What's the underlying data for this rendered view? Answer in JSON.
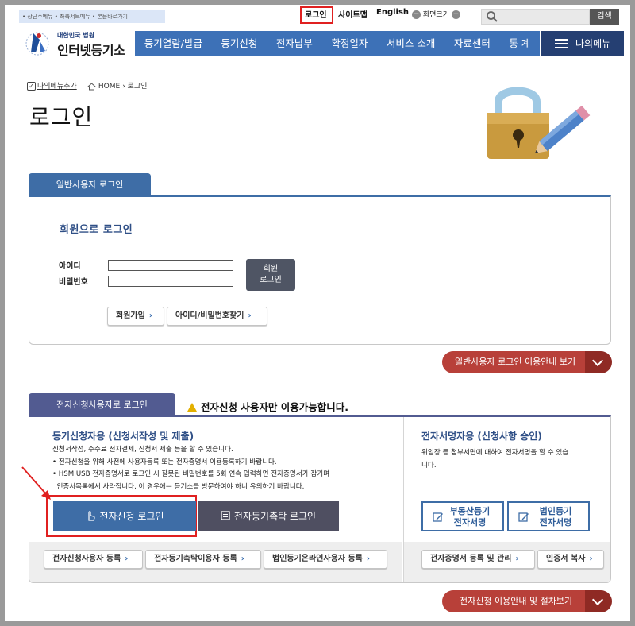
{
  "topbar": {
    "skip_links": "• 상단주메뉴 • 좌측서브메뉴 • 본문바로가기",
    "login": "로그인",
    "sitemap": "사이트맵",
    "english": "English",
    "zoom_label": "화면크기",
    "search_button": "검색"
  },
  "logo": {
    "org": "대한민국 법원",
    "name": "인터넷등기소"
  },
  "nav": {
    "items": [
      "등기열람/발급",
      "등기신청",
      "전자납부",
      "확정일자",
      "서비스 소개",
      "자료센터",
      "통 계"
    ],
    "my_menu": "나의메뉴"
  },
  "breadcrumb": {
    "add_menu": "나의메뉴추가",
    "home": "HOME",
    "current": "로그인"
  },
  "page_title": "로그인",
  "general": {
    "tab": "일반사용자 로그인",
    "member_title": "회원으로 로그인",
    "id_label": "아이디",
    "pw_label": "비밀번호",
    "id_value": "",
    "pw_value": "",
    "login_button_line1": "회원",
    "login_button_line2": "로그인",
    "join": "회원가입",
    "find": "아이디/비밀번호찾기",
    "guide": "일반사용자 로그인 이용안내 보기"
  },
  "efile": {
    "tab": "전자신청사용자로 로그인",
    "notice": "전자신청 사용자만 이용가능합니다.",
    "left_title": "등기신청자용 (신청서작성 및 제출)",
    "left_desc": [
      "신청서작성, 수수료 전자결제, 신청서 제출 등을 할 수 있습니다.",
      "• 전자신청을 위해 사전에 사용자등록 또는 전자증명서 이용등록하기 바랍니다.",
      "• HSM USB 전자증명서로 로그인 시 잘못된 비밀번호를 5회 연속 입력하면 전자증명서가 잠기며",
      "  인증서목록에서 사라집니다. 이 경우에는 등기소를 방문하여야 하니 유의하기 바랍니다."
    ],
    "btn_efile": "전자신청 로그인",
    "btn_trust": "전자등기촉탁 로그인",
    "left_links": [
      "전자신청사용자 등록",
      "전자등기촉탁이용자 등록",
      "법인등기온라인사용자 등록"
    ],
    "right_title": "전자서명자용 (신청사항 승인)",
    "right_desc": [
      "위임장 등 첨부서면에 대하여 전자서명을 할 수 있습",
      "니다."
    ],
    "sign_realty_line1": "부동산등기",
    "sign_realty_line2": "전자서명",
    "sign_corp_line1": "법인등기",
    "sign_corp_line2": "전자서명",
    "right_links": [
      "전자증명서 등록 및 관리",
      "인증서 복사"
    ],
    "guide": "전자신청 이용안내 및 절차보기"
  }
}
